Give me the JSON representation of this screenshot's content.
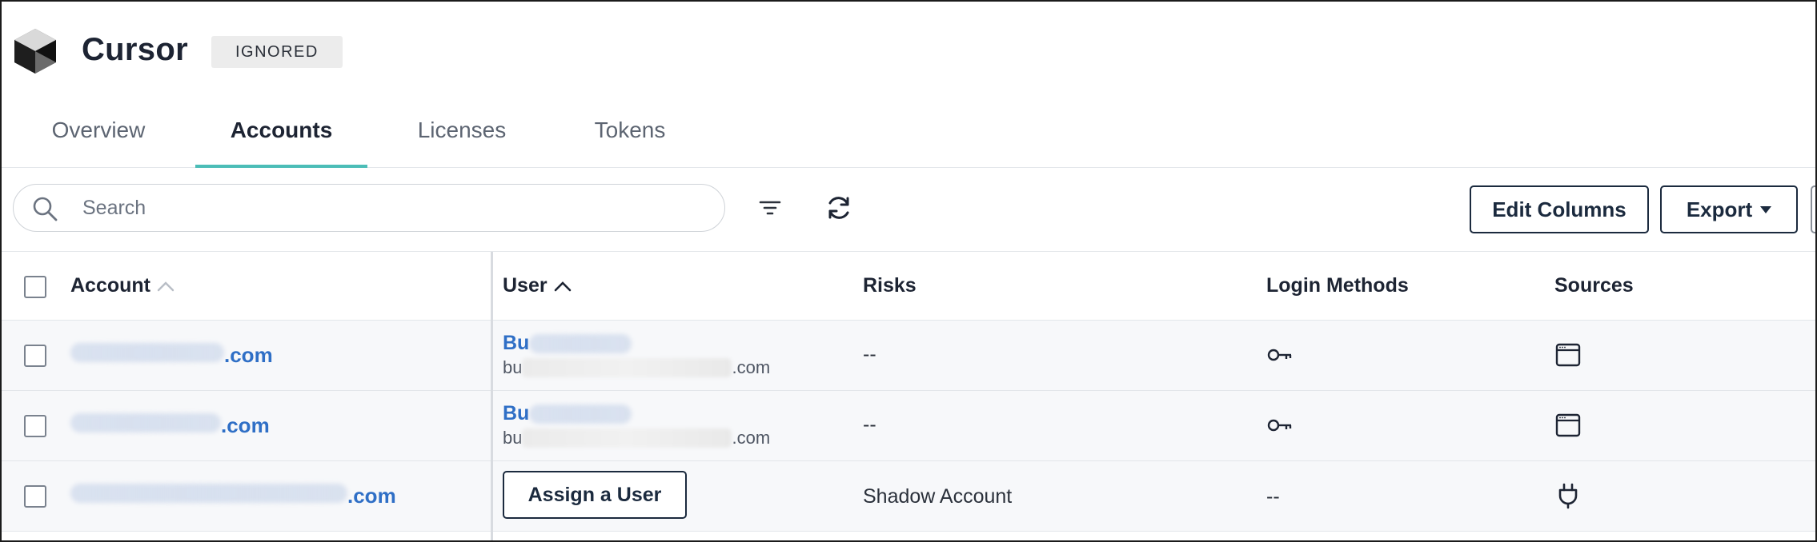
{
  "app": {
    "title": "Cursor",
    "status_badge": "IGNORED",
    "logo_icon": "cube-logo-icon"
  },
  "tabs": [
    {
      "label": "Overview",
      "active": false
    },
    {
      "label": "Accounts",
      "active": true
    },
    {
      "label": "Licenses",
      "active": false
    },
    {
      "label": "Tokens",
      "active": false
    }
  ],
  "toolbar": {
    "search_placeholder": "Search",
    "filter_icon": "filter-icon",
    "refresh_icon": "refresh-icon",
    "edit_columns_label": "Edit Columns",
    "export_label": "Export"
  },
  "table": {
    "columns": {
      "account": "Account",
      "user": "User",
      "risks": "Risks",
      "login_methods": "Login Methods",
      "sources": "Sources"
    },
    "rows": [
      {
        "account_suffix": ".com",
        "user_name_visible": "Bu",
        "user_email_prefix": "bu",
        "user_email_suffix": ".com",
        "risks": "--",
        "login_method_icon": "key-icon",
        "source_icon": "browser-window-icon"
      },
      {
        "account_suffix": ".com",
        "user_name_visible": "Bu",
        "user_email_prefix": "bu",
        "user_email_suffix": ".com",
        "risks": "--",
        "login_method_icon": "key-icon",
        "source_icon": "browser-window-icon"
      },
      {
        "account_suffix": ".com",
        "assign_label": "Assign a User",
        "risks": "Shadow Account",
        "login_methods": "--",
        "source_icon": "plug-icon"
      }
    ]
  },
  "colors": {
    "accent_tab": "#4cbdb7",
    "link": "#2f6fc6",
    "button_border": "#1b2a3e"
  }
}
